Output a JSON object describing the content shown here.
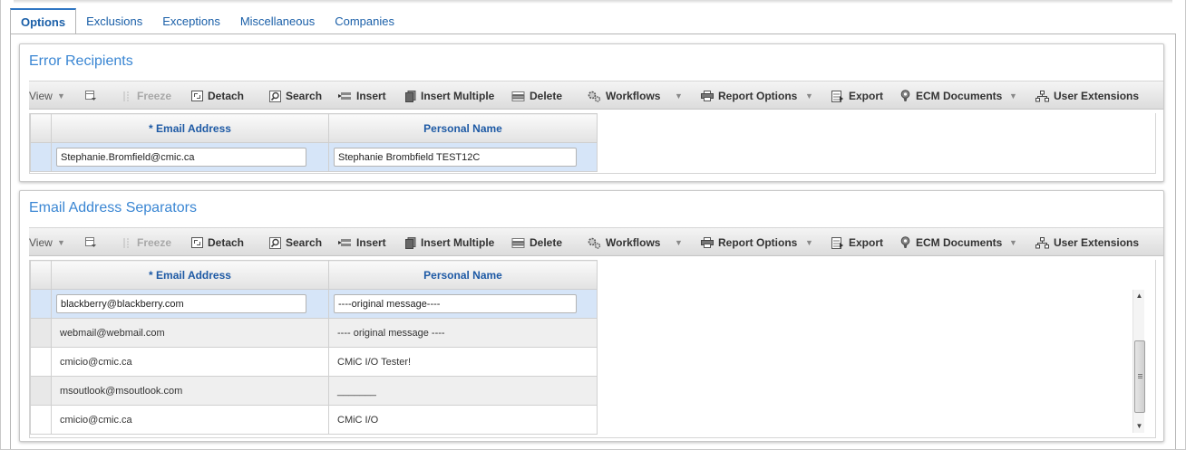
{
  "tabs": [
    {
      "label": "Options",
      "active": true
    },
    {
      "label": "Exclusions"
    },
    {
      "label": "Exceptions"
    },
    {
      "label": "Miscellaneous"
    },
    {
      "label": "Companies"
    }
  ],
  "toolbar": {
    "view": "View",
    "freeze": "Freeze",
    "detach": "Detach",
    "search": "Search",
    "insert": "Insert",
    "insert_multiple": "Insert Multiple",
    "delete": "Delete",
    "workflows": "Workflows",
    "report_options": "Report Options",
    "export": "Export",
    "ecm_documents": "ECM Documents",
    "user_extensions": "User Extensions"
  },
  "error_recipients": {
    "title": "Error Recipients",
    "columns": {
      "email": "* Email Address",
      "name": "Personal Name"
    },
    "rows": [
      {
        "email": "Stephanie.Bromfield@cmic.ca",
        "name": "Stephanie Brombfield TEST12C"
      }
    ]
  },
  "email_separators": {
    "title": "Email Address Separators",
    "columns": {
      "email": "* Email Address",
      "name": "Personal Name"
    },
    "rows": [
      {
        "email": "blackberry@blackberry.com",
        "name": "----original message----"
      },
      {
        "email": "webmail@webmail.com",
        "name": "---- original message ----"
      },
      {
        "email": "cmicio@cmic.ca",
        "name": "CMiC I/O Tester!"
      },
      {
        "email": "msoutlook@msoutlook.com",
        "name": "_______"
      },
      {
        "email": "cmicio@cmic.ca",
        "name": "CMiC I/O"
      }
    ]
  },
  "icons": [
    "column-chooser-icon",
    "freeze-icon",
    "detach-icon",
    "search-icon",
    "insert-icon",
    "insert-multiple-icon",
    "delete-icon",
    "workflows-icon",
    "printer-icon",
    "export-icon",
    "ecm-documents-icon",
    "user-extensions-icon"
  ],
  "colors": {
    "accent": "#3a86d3",
    "header_text": "#1e5aa5",
    "selected_row": "#d6e5f8"
  }
}
